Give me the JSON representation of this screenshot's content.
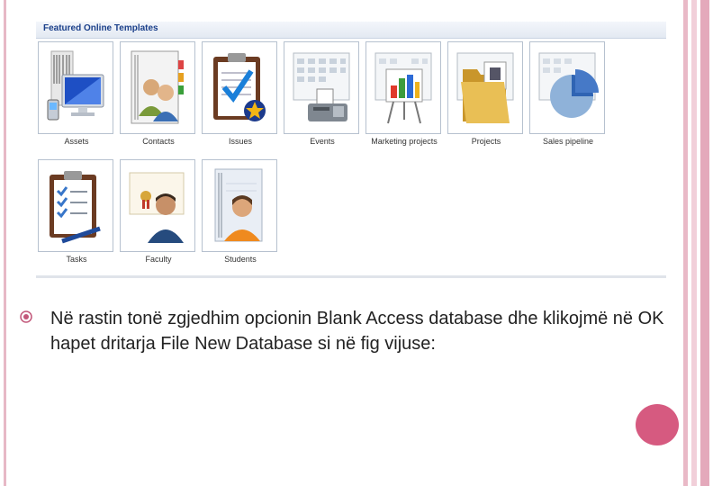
{
  "panel": {
    "title": "Featured Online Templates",
    "templates": [
      {
        "label": "Assets",
        "icon": "monitor-phone-icon"
      },
      {
        "label": "Contacts",
        "icon": "contacts-people-icon"
      },
      {
        "label": "Issues",
        "icon": "clipboard-check-icon"
      },
      {
        "label": "Events",
        "icon": "calendar-fax-icon"
      },
      {
        "label": "Marketing projects",
        "icon": "chart-easel-icon"
      },
      {
        "label": "Projects",
        "icon": "folder-icon"
      },
      {
        "label": "Sales pipeline",
        "icon": "pie-chart-icon"
      },
      {
        "label": "Tasks",
        "icon": "task-checklist-icon"
      },
      {
        "label": "Faculty",
        "icon": "faculty-person-icon"
      },
      {
        "label": "Students",
        "icon": "student-person-icon"
      }
    ]
  },
  "bullet": {
    "text": "Në rastin tonë zgjedhim opcionin Blank Access database dhe klikojmë në OK hapet dritarja File New Database si në fig vijuse:"
  },
  "colors": {
    "accent": "#d65a80",
    "panel_title": "#1a3f8a",
    "bullet": "#c2577a"
  }
}
